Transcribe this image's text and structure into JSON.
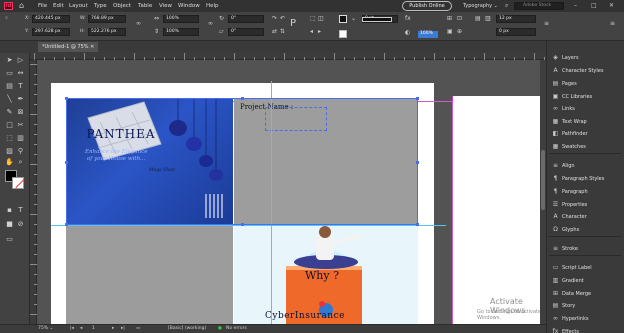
{
  "menubar": {
    "app_logo": "Id",
    "menus": [
      "File",
      "Edit",
      "Layout",
      "Type",
      "Object",
      "Table",
      "View",
      "Window",
      "Help"
    ],
    "publish_label": "Publish Online",
    "workspace": "Typography",
    "search_placeholder": "Adobe Stock"
  },
  "control": {
    "x_label": "X:",
    "x_value": "420.445 px",
    "y_label": "Y:",
    "y_value": "297.628 px",
    "w_label": "W:",
    "w_value": "768.89 px",
    "h_label": "H:",
    "h_value": "522.276 px",
    "scale_x": "100%",
    "scale_y": "100%",
    "rotate": "0°",
    "shear": "0°",
    "stroke_weight": "0 pt",
    "opacity": "100%",
    "spacing": "12 px",
    "fitting_value": "0 px"
  },
  "document": {
    "tab_title": "*Untitled-1 @ 75%"
  },
  "canvas": {
    "panthea": {
      "title": "PANTHEA",
      "tagline_1": "Enhance the Elegance",
      "tagline_2": "of your House with...",
      "signature": "Mega Shop"
    },
    "project_label": "Project Name :",
    "cyber": {
      "why": "Why ?",
      "title": "CyberInsurance"
    },
    "watermark_title": "Activate Windows",
    "watermark_sub": "Go to Settings to activate Windows."
  },
  "status": {
    "zoom": "75%",
    "page": "1",
    "style": "[Basic] (working)",
    "errors": "No errors"
  },
  "panels": [
    {
      "label": "Layers",
      "icon": "layers-icon",
      "glyph": "◈"
    },
    {
      "label": "Character Styles",
      "icon": "character-styles-icon",
      "glyph": "A"
    },
    {
      "label": "Pages",
      "icon": "pages-icon",
      "glyph": "▤"
    },
    {
      "label": "CC Libraries",
      "icon": "libraries-icon",
      "glyph": "▣"
    },
    {
      "label": "Links",
      "icon": "links-icon",
      "glyph": "∞"
    },
    {
      "label": "Text Wrap",
      "icon": "text-wrap-icon",
      "glyph": "▦"
    },
    {
      "label": "Pathfinder",
      "icon": "pathfinder-icon",
      "glyph": "◧"
    },
    {
      "label": "Swatches",
      "icon": "swatches-icon",
      "glyph": "▦"
    },
    {
      "label": "Align",
      "icon": "align-icon",
      "glyph": "≡"
    },
    {
      "label": "Paragraph Styles",
      "icon": "paragraph-styles-icon",
      "glyph": "¶"
    },
    {
      "label": "Paragraph",
      "icon": "paragraph-icon",
      "glyph": "¶"
    },
    {
      "label": "Properties",
      "icon": "properties-icon",
      "glyph": "☰"
    },
    {
      "label": "Character",
      "icon": "character-icon",
      "glyph": "A"
    },
    {
      "label": "Glyphs",
      "icon": "glyphs-icon",
      "glyph": "Ω"
    },
    {
      "label": "Stroke",
      "icon": "stroke-icon",
      "glyph": "≡"
    },
    {
      "label": "Script Label",
      "icon": "script-label-icon",
      "glyph": "▭"
    },
    {
      "label": "Gradient",
      "icon": "gradient-icon",
      "glyph": "▥"
    },
    {
      "label": "Data Merge",
      "icon": "data-merge-icon",
      "glyph": "⊞"
    },
    {
      "label": "Story",
      "icon": "story-icon",
      "glyph": "▤"
    },
    {
      "label": "Hyperlinks",
      "icon": "hyperlinks-icon",
      "glyph": "∞"
    },
    {
      "label": "Effects",
      "icon": "effects-icon",
      "glyph": "fx"
    }
  ],
  "colors": {
    "accent": "#4a6df0",
    "app_brand": "#ff3366",
    "panthea_bg": "#2b55c6"
  }
}
